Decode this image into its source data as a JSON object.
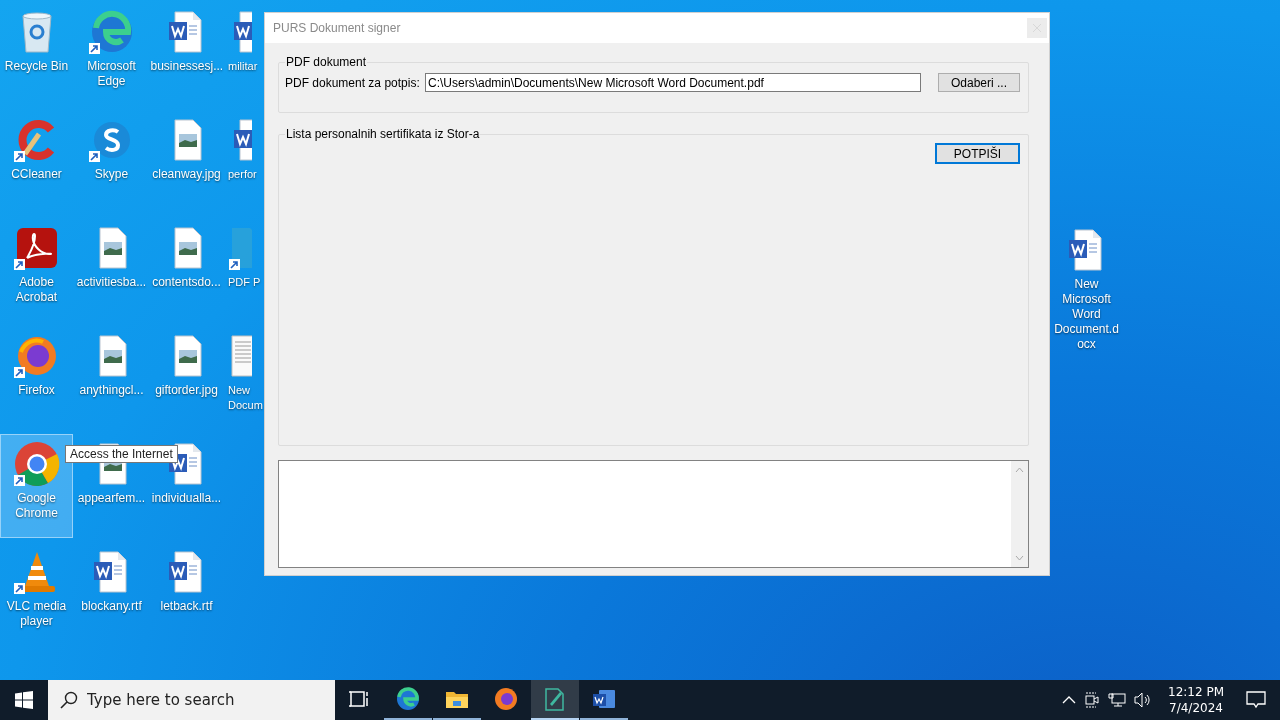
{
  "desktop": {
    "columns": [
      [
        {
          "label": "Recycle Bin",
          "kind": "recycle",
          "shortcut": false,
          "selected": false
        },
        {
          "label": "CCleaner",
          "kind": "ccleaner",
          "shortcut": true,
          "selected": false
        },
        {
          "label": "Adobe Acrobat",
          "kind": "acrobat",
          "shortcut": true,
          "selected": false
        },
        {
          "label": "Firefox",
          "kind": "firefox",
          "shortcut": true,
          "selected": false
        },
        {
          "label": "Google Chrome",
          "kind": "chrome",
          "shortcut": true,
          "selected": true
        },
        {
          "label": "VLC media player",
          "kind": "vlc",
          "shortcut": true,
          "selected": false
        }
      ],
      [
        {
          "label": "Microsoft Edge",
          "kind": "edge",
          "shortcut": true,
          "selected": false
        },
        {
          "label": "Skype",
          "kind": "skype",
          "shortcut": true,
          "selected": false
        },
        {
          "label": "activitiesba...",
          "kind": "image",
          "shortcut": false,
          "selected": false
        },
        {
          "label": "anythingcl...",
          "kind": "image",
          "shortcut": false,
          "selected": false
        },
        {
          "label": "appearfem...",
          "kind": "image",
          "shortcut": false,
          "selected": false
        },
        {
          "label": "blockany.rtf",
          "kind": "word",
          "shortcut": false,
          "selected": false
        }
      ],
      [
        {
          "label": "businessesj...",
          "kind": "word",
          "shortcut": false,
          "selected": false
        },
        {
          "label": "cleanway.jpg",
          "kind": "image",
          "shortcut": false,
          "selected": false
        },
        {
          "label": "contentsdo...",
          "kind": "image",
          "shortcut": false,
          "selected": false
        },
        {
          "label": "giftorder.jpg",
          "kind": "image",
          "shortcut": false,
          "selected": false
        },
        {
          "label": "individualla...",
          "kind": "word",
          "shortcut": false,
          "selected": false
        },
        {
          "label": "letback.rtf",
          "kind": "word",
          "shortcut": false,
          "selected": false
        }
      ],
      [
        {
          "label": "militar",
          "kind": "word",
          "shortcut": false,
          "selected": false
        },
        {
          "label": "perfor",
          "kind": "word",
          "shortcut": false,
          "selected": false
        },
        {
          "label": "PDF P",
          "kind": "pdf",
          "shortcut": true,
          "selected": false
        },
        {
          "label": "New Docum",
          "kind": "text",
          "shortcut": false,
          "selected": false
        }
      ]
    ],
    "tooltip": "Access the Internet",
    "right_icons": [
      {
        "label": "New Microsoft Word Document.docx",
        "kind": "word",
        "shortcut": false,
        "selected": false
      }
    ]
  },
  "window": {
    "title": "PURS Dokument signer",
    "pdf_group": {
      "title": "PDF dokument",
      "field_label": "PDF dokument za potpis:",
      "path": "C:\\Users\\admin\\Documents\\New Microsoft Word Document.pdf",
      "browse_button": "Odaberi ..."
    },
    "cert_group": {
      "title": "Lista personalnih sertifikata iz Stor-a",
      "sign_button": "POTPIŠI"
    }
  },
  "taskbar": {
    "search": {
      "placeholder": "Type here to search"
    },
    "apps": [
      {
        "kind": "taskview",
        "running": false,
        "active": false
      },
      {
        "kind": "edge",
        "running": true,
        "active": false
      },
      {
        "kind": "explorer",
        "running": true,
        "active": false
      },
      {
        "kind": "firefox",
        "running": false,
        "active": false
      },
      {
        "kind": "signer",
        "running": true,
        "active": true
      },
      {
        "kind": "word",
        "running": true,
        "active": false
      }
    ],
    "clock": {
      "time": "12:12 PM",
      "date": "7/4/2024"
    }
  }
}
